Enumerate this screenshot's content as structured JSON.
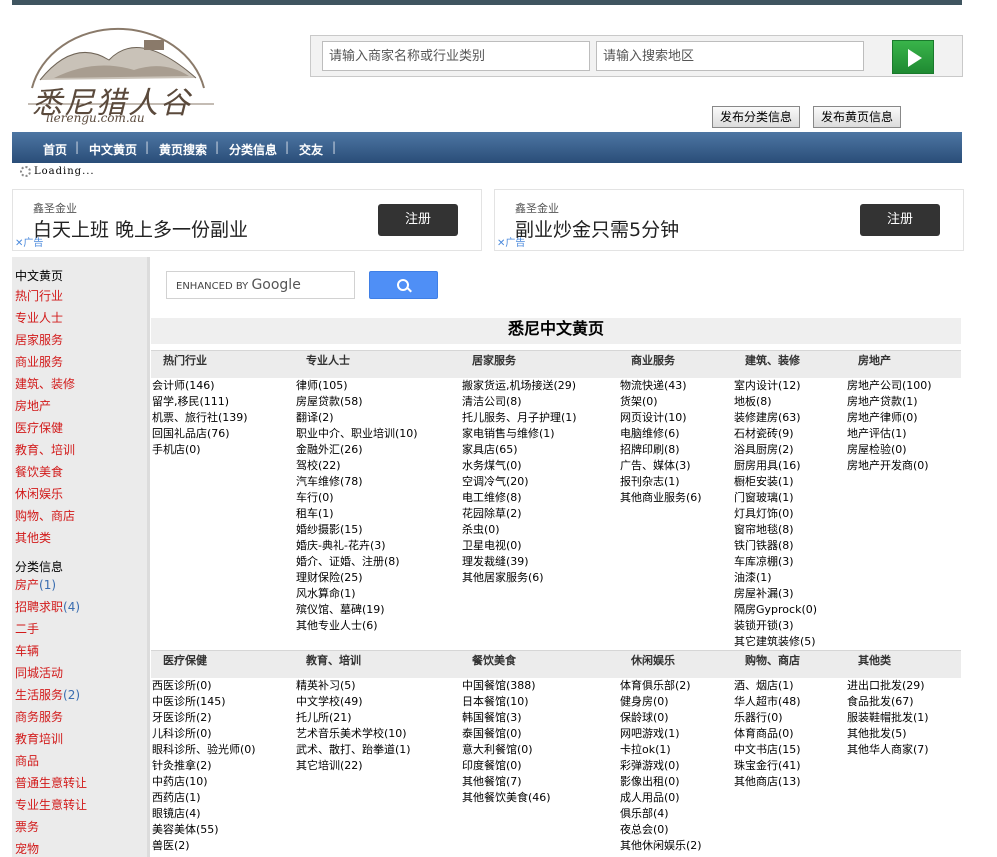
{
  "site": {
    "logo_text": "悉尼猎人谷",
    "logo_domain": "lierengu.com.au",
    "search_business_placeholder": "请输入商家名称或行业类别",
    "search_area_placeholder": "请输入搜索地区",
    "post_classified": "发布分类信息",
    "post_yellowpage": "发布黄页信息"
  },
  "nav": [
    "首页",
    "中文黄页",
    "黄页搜索",
    "分类信息",
    "交友"
  ],
  "loading": "Loading...",
  "ads": [
    {
      "brand": "鑫圣金业",
      "text": "白天上班 晚上多一份副业",
      "button": "注册",
      "label": "广告"
    },
    {
      "brand": "鑫圣金业",
      "text": "副业炒金只需5分钟",
      "button": "注册",
      "label": "广告"
    }
  ],
  "sidebar": {
    "section1_title": "中文黄页",
    "section1_links": [
      "热门行业",
      "专业人士",
      "居家服务",
      "商业服务",
      "建筑、装修",
      "房地产",
      "医疗保健",
      "教育、培训",
      "餐饮美食",
      "休闲娱乐",
      "购物、商店",
      "其他类"
    ],
    "section2_title": "分类信息",
    "section2_links": [
      {
        "label": "房产",
        "count": "(1)"
      },
      {
        "label": "招聘求职",
        "count": "(4)"
      },
      {
        "label": "二手",
        "count": ""
      },
      {
        "label": "车辆",
        "count": ""
      },
      {
        "label": "同城活动",
        "count": ""
      },
      {
        "label": "生活服务",
        "count": "(2)"
      },
      {
        "label": "商务服务",
        "count": ""
      },
      {
        "label": "教育培训",
        "count": ""
      },
      {
        "label": "商品",
        "count": ""
      },
      {
        "label": "普通生意转让",
        "count": ""
      },
      {
        "label": "专业生意转让",
        "count": ""
      },
      {
        "label": "票务",
        "count": ""
      },
      {
        "label": "宠物",
        "count": ""
      }
    ]
  },
  "google": {
    "label": "ENHANCED BY",
    "brand": "Google"
  },
  "page_title": "悉尼中文黄页",
  "sections": [
    {
      "headers": [
        "热门行业",
        "专业人士",
        "居家服务",
        "商业服务",
        "建筑、装修",
        "房地产"
      ],
      "columns": [
        [
          "会计师(146)",
          "留学,移民(111)",
          "机票、旅行社(139)",
          "回国礼品店(76)",
          "手机店(0)"
        ],
        [
          "律师(105)",
          "房屋贷款(58)",
          "翻译(2)",
          "职业中介、职业培训(10)",
          "金融外汇(26)",
          "驾校(22)",
          "汽车维修(78)",
          "车行(0)",
          "租车(1)",
          "婚纱摄影(15)",
          "婚庆-典礼-花卉(3)",
          "婚介、证婚、注册(8)",
          "理财保险(25)",
          "风水算命(1)",
          "殡仪馆、墓碑(19)",
          "其他专业人士(6)"
        ],
        [
          "搬家货运,机场接送(29)",
          "清洁公司(8)",
          "托儿服务、月子护理(1)",
          "家电销售与维修(1)",
          "家具店(65)",
          "水务煤气(0)",
          "空调冷气(20)",
          "电工维修(8)",
          "花园除草(2)",
          "杀虫(0)",
          "卫星电视(0)",
          "理发裁缝(39)",
          "其他居家服务(6)"
        ],
        [
          "物流快递(43)",
          "货架(0)",
          "网页设计(10)",
          "电脑维修(6)",
          "招牌印刷(8)",
          "广告、媒体(3)",
          "报刊杂志(1)",
          "其他商业服务(6)"
        ],
        [
          "室内设计(12)",
          "地板(8)",
          "装修建房(63)",
          "石材瓷砖(9)",
          "浴具厨房(2)",
          "厨房用具(16)",
          "橱柜安装(1)",
          "门窗玻璃(1)",
          "灯具灯饰(0)",
          "窗帘地毯(8)",
          "铁门铁器(8)",
          "车库凉棚(3)",
          "油漆(1)",
          "房屋补漏(3)",
          "隔房Gyprock(0)",
          "装锁开锁(3)",
          "其它建筑装修(5)"
        ],
        [
          "房地产公司(100)",
          "房地产贷款(1)",
          "房地产律师(0)",
          "地产评估(1)",
          "房屋检验(0)",
          "房地产开发商(0)"
        ]
      ]
    },
    {
      "headers": [
        "医疗保健",
        "教育、培训",
        "餐饮美食",
        "休闲娱乐",
        "购物、商店",
        "其他类"
      ],
      "columns": [
        [
          "西医诊所(0)",
          "中医诊所(145)",
          "牙医诊所(2)",
          "儿科诊所(0)",
          "眼科诊所、验光师(0)",
          "针灸推拿(2)",
          "中药店(10)",
          "西药店(1)",
          "眼镜店(4)",
          "美容美体(55)",
          "兽医(2)"
        ],
        [
          "精英补习(5)",
          "中文学校(49)",
          "托儿所(21)",
          "艺术音乐美术学校(10)",
          "武术、散打、跆拳道(1)",
          "其它培训(22)"
        ],
        [
          "中国餐馆(388)",
          "日本餐馆(10)",
          "韩国餐馆(3)",
          "泰国餐馆(0)",
          "意大利餐馆(0)",
          "印度餐馆(0)",
          "其他餐馆(7)",
          "其他餐饮美食(46)"
        ],
        [
          "体育俱乐部(2)",
          "健身房(0)",
          "保龄球(0)",
          "网吧游戏(1)",
          "卡拉ok(1)",
          "彩弹游戏(0)",
          "影像出租(0)",
          "成人用品(0)",
          "俱乐部(4)",
          "夜总会(0)",
          "其他休闲娱乐(2)"
        ],
        [
          "酒、烟店(1)",
          "华人超市(48)",
          "乐器行(0)",
          "体育商品(0)",
          "中文书店(15)",
          "珠宝金行(41)",
          "其他商店(13)"
        ],
        [
          "进出口批发(29)",
          "食品批发(67)",
          "服装鞋帽批发(1)",
          "其他批发(5)",
          "其他华人商家(7)"
        ]
      ]
    }
  ]
}
